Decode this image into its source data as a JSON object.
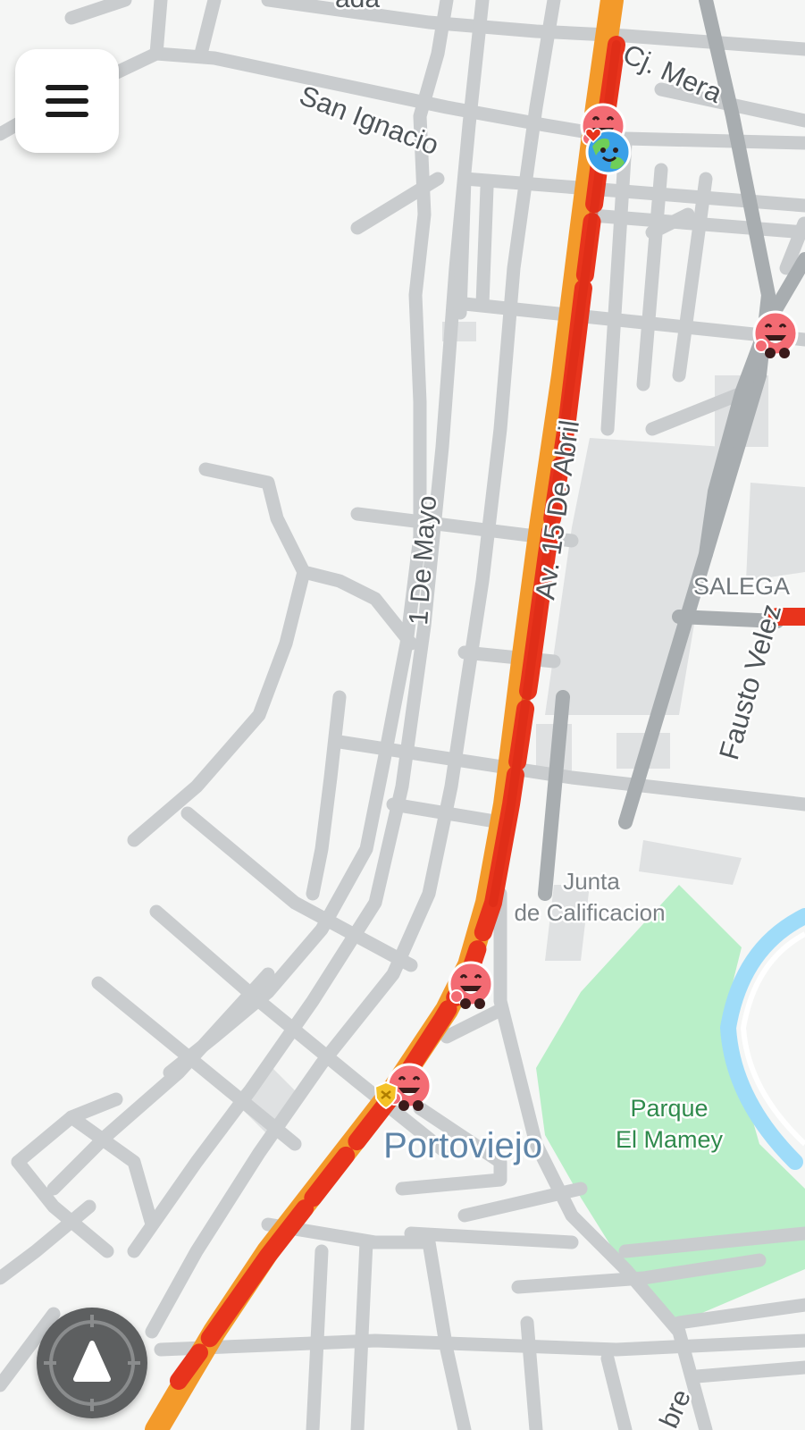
{
  "map": {
    "colors": {
      "background": "#f5f6f5",
      "road": "#c9ccce",
      "road_major": "#a8adb0",
      "traffic_heavy": "#e8341c",
      "traffic_moderate": "#f39a2a",
      "park": "#b9efc8",
      "river": "#9fdcf9",
      "building": "#dfe1e2"
    },
    "labels": {
      "top_partial": "ada",
      "cj_mera": "Cj. Mera",
      "san_ignacio": "San Ignacio",
      "av_15_abril": "Av. 15 De Abril",
      "primero_mayo": "1 De Mayo",
      "salega": "SALEGA",
      "fausto_velez": "Fausto Velez",
      "junta_line1": "Junta",
      "junta_line2": "de Calificacion",
      "park_line1": "Parque",
      "park_line2": "El Mamey",
      "city": "Portoviejo",
      "bottom_partial": "bre"
    },
    "markers": [
      {
        "type": "wazer",
        "icon": "wazer-happy-icon"
      },
      {
        "type": "wazer",
        "icon": "wazer-happy-icon"
      },
      {
        "type": "wazer",
        "icon": "wazer-happy-icon"
      },
      {
        "type": "wazer",
        "icon": "wazer-happy-icon"
      },
      {
        "type": "wazer-world",
        "icon": "wazer-world-icon"
      },
      {
        "type": "police-badge",
        "icon": "police-badge-icon"
      }
    ]
  },
  "controls": {
    "menu_icon": "menu-icon",
    "recenter_icon": "recenter-navigation-icon"
  }
}
